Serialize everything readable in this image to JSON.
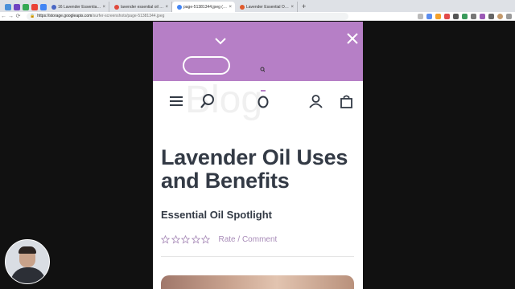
{
  "browser": {
    "tabs": [
      {
        "label": "16 Lavender Essential Oil Ben",
        "active": false,
        "favicon_color": "#4a67c4"
      },
      {
        "label": "lavender essential oil benefits",
        "active": false,
        "favicon_color": "#e04a3d"
      },
      {
        "label": "page-51381344.jpeg (782×1",
        "active": true,
        "favicon_color": "#4285f4"
      },
      {
        "label": "Lavender Essential Oil Benefi",
        "active": false,
        "favicon_color": "#e05a2b"
      }
    ],
    "new_tab": "+",
    "close_glyph": "×",
    "nav": {
      "back": "←",
      "forward": "→",
      "reload": "⟳"
    },
    "url_host": "https://storage.googleapis.com",
    "url_path": "/surfer-screenshots/page-51381344.jpeg"
  },
  "promo_banner": {
    "background": "#b67fc6",
    "button_label": ""
  },
  "site_header": {
    "ghost_text": "Blog"
  },
  "article": {
    "title": "Lavender Oil Uses and Benefits",
    "subtitle": "Essential Oil Spotlight",
    "rating_stars": 0,
    "rating_max": 5,
    "rate_label": "Rate / Comment"
  },
  "colors": {
    "accent": "#b67fc6",
    "heading": "#333a45",
    "link": "#a88bb8"
  }
}
